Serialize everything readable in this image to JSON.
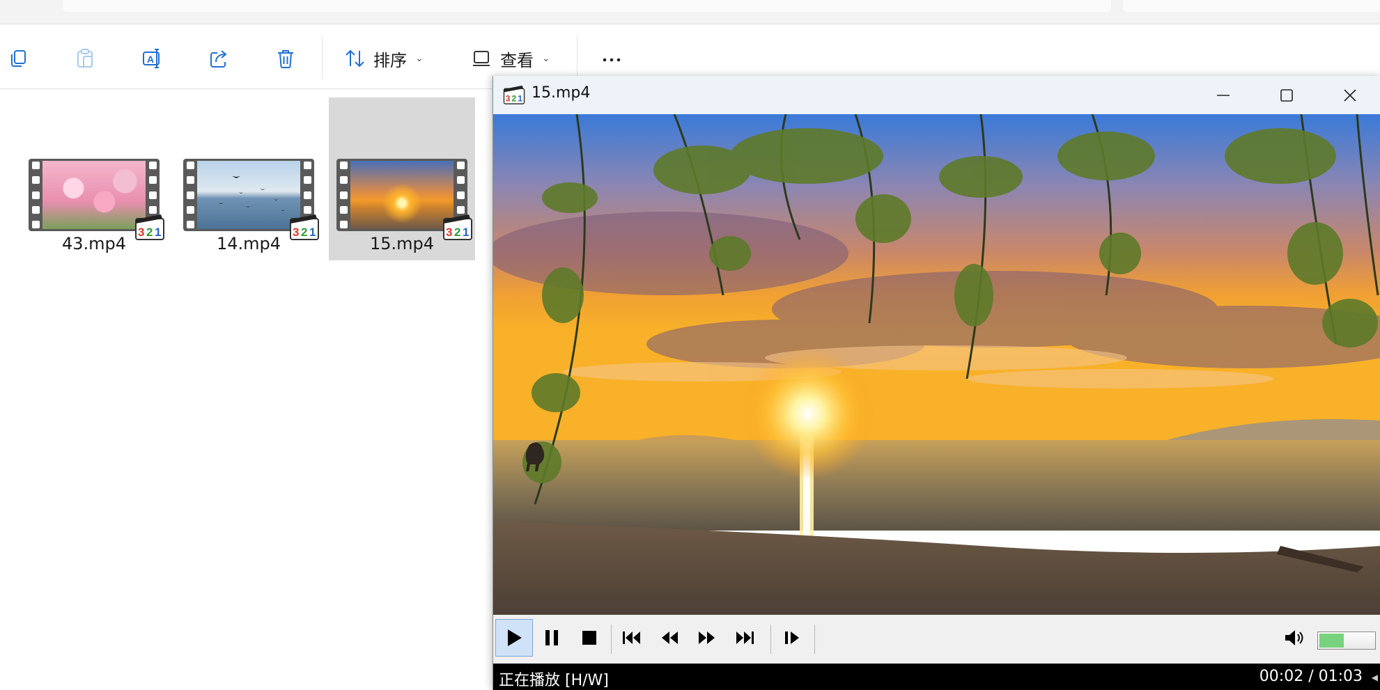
{
  "toolbar": {
    "sort_label": "排序",
    "view_label": "查看"
  },
  "files": [
    {
      "name": "43.mp4",
      "selected": false
    },
    {
      "name": "14.mp4",
      "selected": false
    },
    {
      "name": "15.mp4",
      "selected": true
    }
  ],
  "player": {
    "title": "15.mp4",
    "status": "正在播放 [H/W]",
    "time": "00:02 / 01:03",
    "volume_level": 0.45,
    "accent_color": "#79d27e"
  }
}
